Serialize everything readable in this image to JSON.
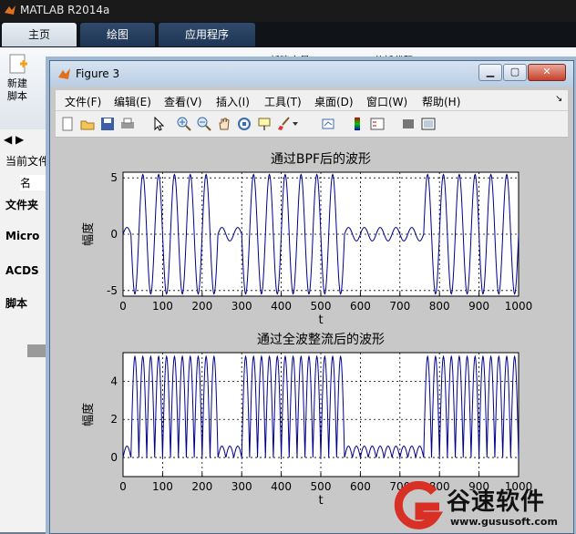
{
  "main_window": {
    "title": "MATLAB R2014a",
    "tabs": [
      "主页",
      "绘图",
      "应用程序"
    ],
    "ribbon": {
      "new_script": "新建\n脚本",
      "new_var": "新建变量",
      "analyze": "分析代码"
    },
    "left_panel": {
      "current_folder": "当前文件",
      "col_name": "名",
      "sections": [
        "文件夹",
        "Micro",
        "ACDS",
        "脚本"
      ]
    }
  },
  "figure": {
    "title": "Figure 3",
    "menu": [
      "文件(F)",
      "编辑(E)",
      "查看(V)",
      "插入(I)",
      "工具(T)",
      "桌面(D)",
      "窗口(W)",
      "帮助(H)"
    ],
    "toolbar_icons": [
      "new-figure-icon",
      "open-file-icon",
      "save-icon",
      "print-icon",
      "pointer-icon",
      "zoom-in-icon",
      "zoom-out-icon",
      "pan-hand-icon",
      "rotate-3d-icon",
      "data-cursor-icon",
      "brush-icon",
      "link-plot-icon",
      "colorbar-icon",
      "legend-icon",
      "hide-plot-tools-icon",
      "show-plot-tools-icon"
    ]
  },
  "watermark": {
    "brand": "谷速软件",
    "url": "www.gususoft.com",
    "accent": "#d93025"
  },
  "chart_data": [
    {
      "type": "line",
      "title": "通过BPF后的波形",
      "xlabel": "t",
      "ylabel": "幅度",
      "xlim": [
        0,
        1000
      ],
      "ylim": [
        -5.5,
        5.5
      ],
      "xticks": [
        0,
        100,
        200,
        300,
        400,
        500,
        600,
        700,
        800,
        900,
        1000
      ],
      "yticks": [
        -5,
        0,
        5
      ],
      "grid": true,
      "color": "#00008b",
      "segments": [
        {
          "t0": 0,
          "t1": 20,
          "amp": 0.6,
          "period": 40
        },
        {
          "t0": 20,
          "t1": 240,
          "amp": 5.3,
          "period": 40
        },
        {
          "t0": 240,
          "t1": 300,
          "amp": 0.6,
          "period": 40
        },
        {
          "t0": 300,
          "t1": 560,
          "amp": 5.3,
          "period": 40
        },
        {
          "t0": 560,
          "t1": 760,
          "amp": 0.6,
          "period": 40
        },
        {
          "t0": 760,
          "t1": 1000,
          "amp": 5.3,
          "period": 40
        }
      ]
    },
    {
      "type": "line",
      "title": "通过全波整流后的波形",
      "xlabel": "t",
      "ylabel": "幅度",
      "xlim": [
        0,
        1000
      ],
      "ylim": [
        -1,
        5.5
      ],
      "xticks": [
        0,
        100,
        200,
        300,
        400,
        500,
        600,
        700,
        800,
        900,
        1000
      ],
      "yticks": [
        0,
        2,
        4
      ],
      "grid": true,
      "color": "#00008b",
      "segments": [
        {
          "t0": 0,
          "t1": 20,
          "amp": 0.6,
          "period": 40
        },
        {
          "t0": 20,
          "t1": 240,
          "amp": 5.3,
          "period": 40
        },
        {
          "t0": 240,
          "t1": 300,
          "amp": 0.6,
          "period": 40
        },
        {
          "t0": 300,
          "t1": 560,
          "amp": 5.3,
          "period": 40
        },
        {
          "t0": 560,
          "t1": 760,
          "amp": 0.6,
          "period": 40
        },
        {
          "t0": 760,
          "t1": 1000,
          "amp": 5.3,
          "period": 40
        }
      ],
      "rectified": true
    }
  ]
}
